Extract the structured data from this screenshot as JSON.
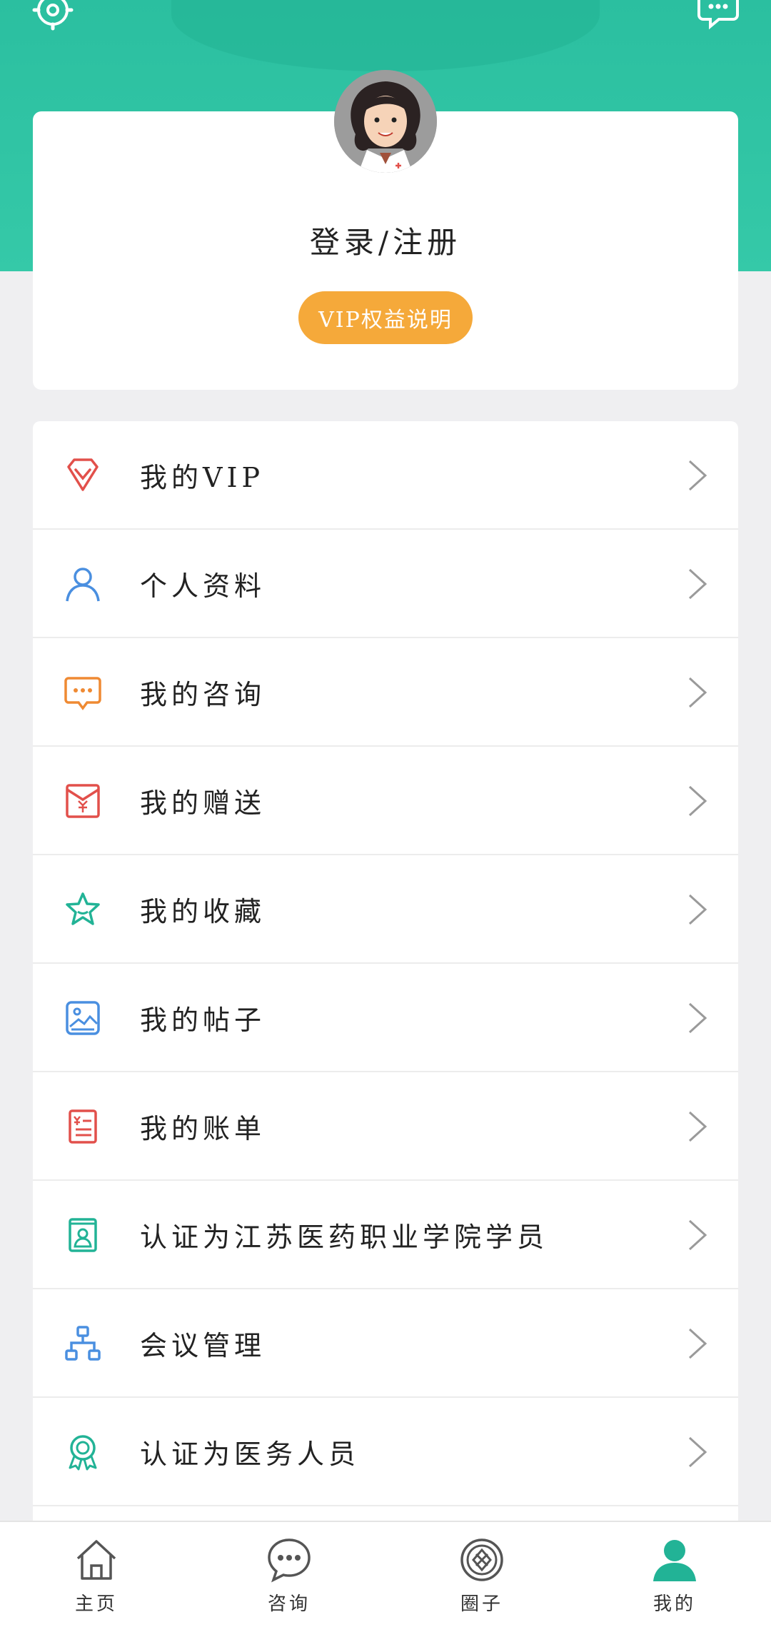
{
  "profile": {
    "login_label": "登录/注册",
    "vip_button": "VIP权益说明"
  },
  "menu": [
    {
      "label": "我的VIP",
      "icon": "diamond-icon",
      "color": "#e2504b"
    },
    {
      "label": "个人资料",
      "icon": "person-icon",
      "color": "#4a8fe0"
    },
    {
      "label": "我的咨询",
      "icon": "chat-bubble-icon",
      "color": "#ef8a33"
    },
    {
      "label": "我的赠送",
      "icon": "gift-envelope-icon",
      "color": "#e2504b"
    },
    {
      "label": "我的收藏",
      "icon": "star-icon",
      "color": "#22b396"
    },
    {
      "label": "我的帖子",
      "icon": "image-icon",
      "color": "#4a8fe0"
    },
    {
      "label": "我的账单",
      "icon": "bill-icon",
      "color": "#e2504b"
    },
    {
      "label": "认证为江苏医药职业学院学员",
      "icon": "student-card-icon",
      "color": "#22b396"
    },
    {
      "label": "会议管理",
      "icon": "org-chart-icon",
      "color": "#4a8fe0"
    },
    {
      "label": "认证为医务人员",
      "icon": "award-icon",
      "color": "#22b396"
    }
  ],
  "tabs": [
    {
      "label": "主页",
      "icon": "home-icon"
    },
    {
      "label": "咨询",
      "icon": "chat-icon"
    },
    {
      "label": "圈子",
      "icon": "circle-icon"
    },
    {
      "label": "我的",
      "icon": "user-icon",
      "active": true
    }
  ],
  "colors": {
    "header": "#2bbfa0",
    "accent": "#22b396",
    "vip_pill": "#f5a93a"
  }
}
